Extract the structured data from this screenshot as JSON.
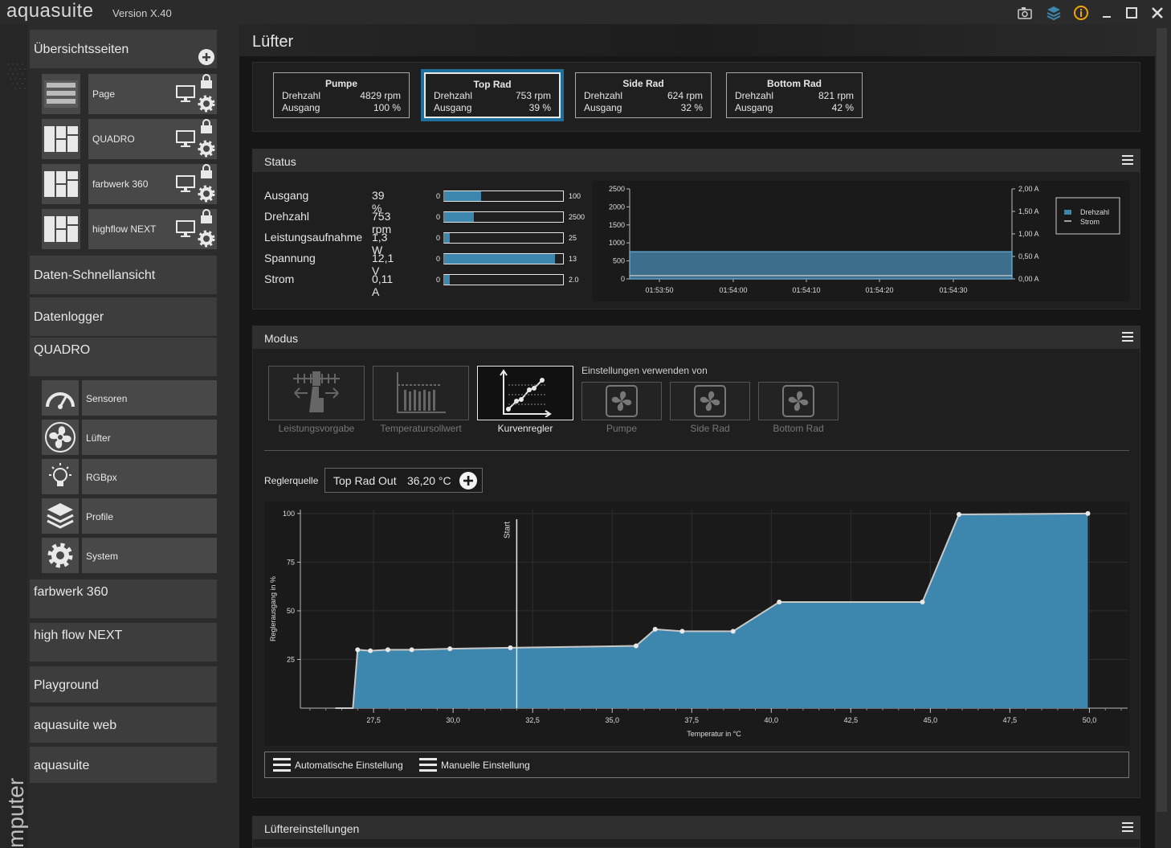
{
  "app": {
    "title": "aquasuite",
    "version": "Version X.40",
    "vertical_label": "mputer"
  },
  "sidebar": {
    "overview": "Übersichtsseiten",
    "pages": [
      {
        "label": "Page"
      },
      {
        "label": "QUADRO"
      },
      {
        "label": "farbwerk 360"
      },
      {
        "label": "highflow NEXT"
      }
    ],
    "quickview": "Daten-Schnellansicht",
    "datalogger": "Datenlogger",
    "device": "QUADRO",
    "modules": [
      {
        "label": "Sensoren",
        "icon": "gauge-icon"
      },
      {
        "label": "Lüfter",
        "icon": "fan-icon"
      },
      {
        "label": "RGBpx",
        "icon": "lightbulb-icon"
      },
      {
        "label": "Profile",
        "icon": "layers-icon"
      },
      {
        "label": "System",
        "icon": "gear-icon"
      }
    ],
    "devices_more": [
      "farbwerk 360",
      "high flow NEXT",
      "Playground",
      "aquasuite web",
      "aquasuite"
    ]
  },
  "page": {
    "title": "Lüfter"
  },
  "fans": [
    {
      "name": "Pumpe",
      "rpm_label": "Drehzahl",
      "rpm": "4829 rpm",
      "out_label": "Ausgang",
      "out": "100 %"
    },
    {
      "name": "Top Rad",
      "rpm_label": "Drehzahl",
      "rpm": "753 rpm",
      "out_label": "Ausgang",
      "out": "39 %"
    },
    {
      "name": "Side Rad",
      "rpm_label": "Drehzahl",
      "rpm": "624 rpm",
      "out_label": "Ausgang",
      "out": "32 %"
    },
    {
      "name": "Bottom Rad",
      "rpm_label": "Drehzahl",
      "rpm": "821 rpm",
      "out_label": "Ausgang",
      "out": "42 %"
    }
  ],
  "status": {
    "title": "Status",
    "rows": [
      {
        "label": "Ausgang",
        "value": "39 %",
        "min": "0",
        "max": "100",
        "fill": 0.31
      },
      {
        "label": "Drehzahl",
        "value": "753 rpm",
        "min": "0",
        "max": "2500",
        "fill": 0.25
      },
      {
        "label": "Leistungsaufnahme",
        "value": "1,3 W",
        "min": "0",
        "max": "25",
        "fill": 0.05
      },
      {
        "label": "Spannung",
        "value": "12,1 V",
        "min": "0",
        "max": "13",
        "fill": 0.93
      },
      {
        "label": "Strom",
        "value": "0,11 A",
        "min": "0",
        "max": "2.0",
        "fill": 0.05
      }
    ],
    "legend": [
      "Drehzahl",
      "Strom"
    ]
  },
  "modus": {
    "title": "Modus",
    "modes": [
      "Leistungsvorgabe",
      "Temperatursollwert",
      "Kurvenregler"
    ],
    "settings_from": "Einstellungen verwenden von",
    "sources": [
      "Pumpe",
      "Side Rad",
      "Bottom Rad"
    ],
    "regler_label": "Reglerquelle",
    "regler_sensor": "Top Rad Out",
    "regler_temp": "36,20 °C",
    "auto_label": "Automatische Einstellung",
    "manual_label": "Manuelle Einstellung"
  },
  "bottom_panel": {
    "title": "Lüftereinstellungen"
  },
  "colors": {
    "accent": "#3d86ad",
    "selected_outline": "#1e6f9c",
    "warning": "#f0a500"
  },
  "chart_data": [
    {
      "type": "area",
      "series": [
        {
          "name": "Drehzahl",
          "values": [
            753,
            753,
            753,
            753,
            753,
            753
          ]
        },
        {
          "name": "Strom",
          "values": [
            0.11,
            0.11,
            0.11,
            0.11,
            0.11,
            0.11
          ]
        }
      ],
      "x": [
        "01:53:50",
        "01:54:00",
        "01:54:10",
        "01:54:20",
        "01:54:30"
      ],
      "y_left_ticks": [
        "0",
        "500",
        "1000",
        "1500",
        "2000",
        "2500"
      ],
      "y_right_ticks": [
        "0,00 A",
        "0,50 A",
        "1,00 A",
        "1,50 A",
        "2,00 A"
      ],
      "ylim_left": [
        0,
        2500
      ],
      "ylim_right": [
        0,
        2.0
      ],
      "legend": "top-right"
    },
    {
      "type": "area",
      "xlabel": "Temperatur in °C",
      "ylabel": "Reglerausgang in %",
      "x_ticks": [
        "27,5",
        "30,0",
        "32,5",
        "35,0",
        "37,5",
        "40,0",
        "42,5",
        "45,0",
        "47,5",
        "50,0"
      ],
      "y_ticks": [
        "25",
        "50",
        "75",
        "100"
      ],
      "xlim": [
        25.2,
        51.2
      ],
      "ylim": [
        0,
        102
      ],
      "marker_label": "Start",
      "marker_x": 32,
      "points": [
        [
          26.3,
          0
        ],
        [
          26.85,
          0
        ],
        [
          27.0,
          30
        ],
        [
          27.4,
          29.5
        ],
        [
          27.95,
          30
        ],
        [
          28.7,
          30
        ],
        [
          29.9,
          30.5
        ],
        [
          31.8,
          31
        ],
        [
          35.75,
          32
        ],
        [
          36.35,
          40.5
        ],
        [
          37.2,
          39.5
        ],
        [
          38.8,
          39.5
        ],
        [
          40.25,
          54.5
        ],
        [
          44.75,
          54.5
        ],
        [
          45.9,
          99.5
        ],
        [
          49.95,
          100
        ],
        [
          49.95,
          0
        ]
      ]
    }
  ]
}
